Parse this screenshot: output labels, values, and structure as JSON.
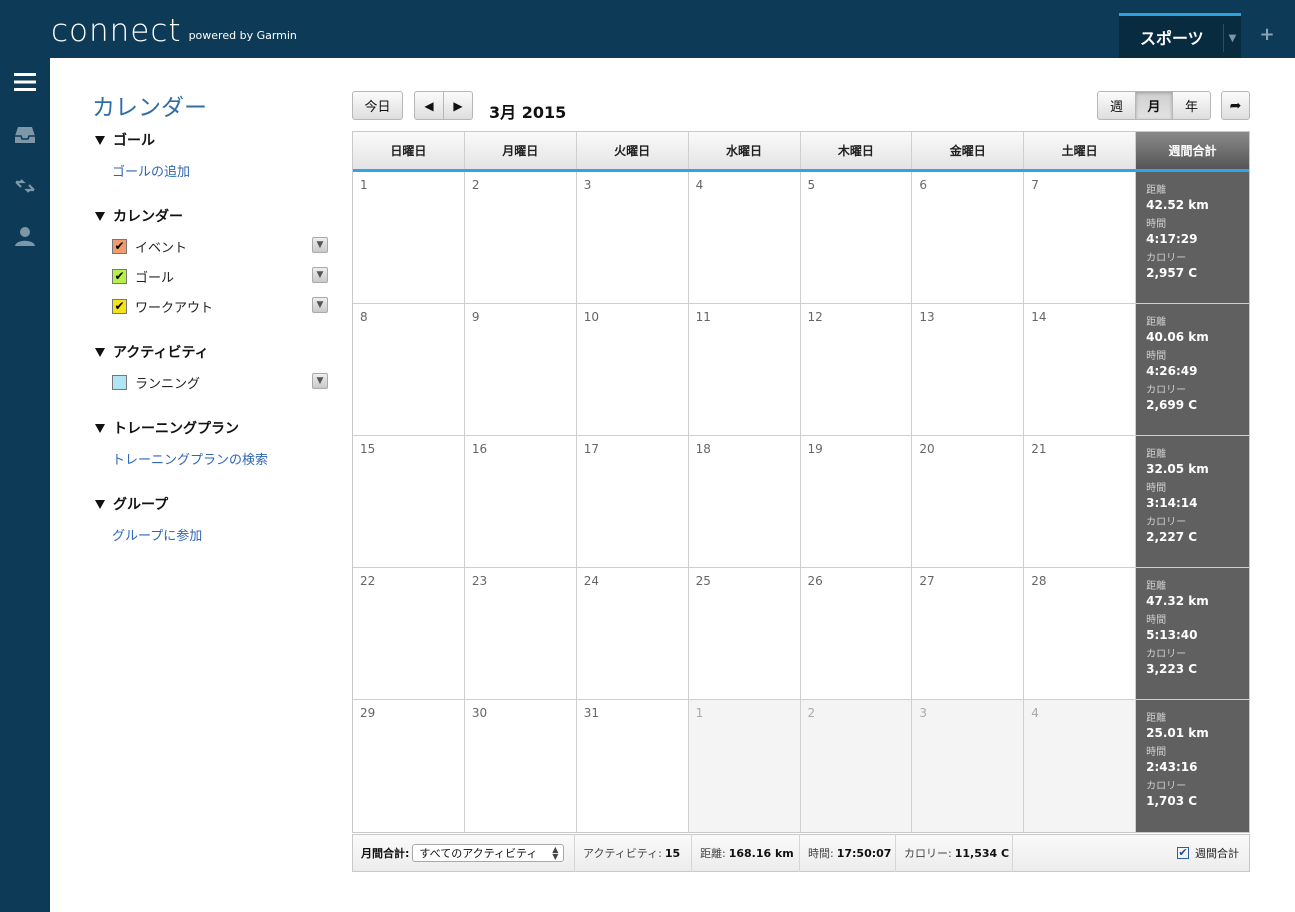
{
  "app": {
    "logo": "connect",
    "logo_sub": "powered by Garmin"
  },
  "topnav": {
    "tab_label": "スポーツ",
    "plus": "+"
  },
  "sidebar": {
    "title": "カレンダー",
    "goals": {
      "header": "ゴール",
      "link": "ゴールの追加"
    },
    "calendars": {
      "header": "カレンダー",
      "items": [
        {
          "label": "イベント",
          "color": "#f39b6d",
          "checked": true
        },
        {
          "label": "ゴール",
          "color": "#b8f04a",
          "checked": true
        },
        {
          "label": "ワークアウト",
          "color": "#f6e21a",
          "checked": true
        }
      ]
    },
    "activities": {
      "header": "アクティビティ",
      "items": [
        {
          "label": "ランニング",
          "color": "#aee6f6",
          "checked": false
        }
      ]
    },
    "training": {
      "header": "トレーニングプラン",
      "link": "トレーニングプランの検索"
    },
    "groups": {
      "header": "グループ",
      "link": "グループに参加"
    }
  },
  "toolbar": {
    "today": "今日",
    "prev": "◀",
    "next": "▶",
    "month_title": "3月 2015",
    "views": [
      "週",
      "月",
      "年"
    ],
    "active_view": "月",
    "share": "➦"
  },
  "calendar": {
    "weekdays": [
      "日曜日",
      "月曜日",
      "火曜日",
      "水曜日",
      "木曜日",
      "金曜日",
      "土曜日"
    ],
    "total_header": "週間合計",
    "weeks": [
      {
        "days": [
          "1",
          "2",
          "3",
          "4",
          "5",
          "6",
          "7"
        ],
        "other": [
          false,
          false,
          false,
          false,
          false,
          false,
          false
        ],
        "totals": {
          "distance_label": "距離",
          "distance": "42.52 km",
          "time_label": "時間",
          "time": "4:17:29",
          "cal_label": "カロリー",
          "calories": "2,957 C"
        }
      },
      {
        "days": [
          "8",
          "9",
          "10",
          "11",
          "12",
          "13",
          "14"
        ],
        "other": [
          false,
          false,
          false,
          false,
          false,
          false,
          false
        ],
        "totals": {
          "distance_label": "距離",
          "distance": "40.06 km",
          "time_label": "時間",
          "time": "4:26:49",
          "cal_label": "カロリー",
          "calories": "2,699 C"
        }
      },
      {
        "days": [
          "15",
          "16",
          "17",
          "18",
          "19",
          "20",
          "21"
        ],
        "other": [
          false,
          false,
          false,
          false,
          false,
          false,
          false
        ],
        "totals": {
          "distance_label": "距離",
          "distance": "32.05 km",
          "time_label": "時間",
          "time": "3:14:14",
          "cal_label": "カロリー",
          "calories": "2,227 C"
        }
      },
      {
        "days": [
          "22",
          "23",
          "24",
          "25",
          "26",
          "27",
          "28"
        ],
        "other": [
          false,
          false,
          false,
          false,
          false,
          false,
          false
        ],
        "totals": {
          "distance_label": "距離",
          "distance": "47.32 km",
          "time_label": "時間",
          "time": "5:13:40",
          "cal_label": "カロリー",
          "calories": "3,223 C"
        }
      },
      {
        "days": [
          "29",
          "30",
          "31",
          "1",
          "2",
          "3",
          "4"
        ],
        "other": [
          false,
          false,
          false,
          true,
          true,
          true,
          true
        ],
        "totals": {
          "distance_label": "距離",
          "distance": "25.01 km",
          "time_label": "時間",
          "time": "2:43:16",
          "cal_label": "カロリー",
          "calories": "1,703 C"
        }
      }
    ]
  },
  "footer": {
    "monthly_label": "月間合計:",
    "filter_value": "すべてのアクティビティ",
    "activities_label": "アクティビティ:",
    "activities_value": "15",
    "distance_label": "距離:",
    "distance_value": "168.16 km",
    "time_label": "時間:",
    "time_value": "17:50:07",
    "calories_label": "カロリー:",
    "calories_value": "11,534 C",
    "weekly_total_label": "週間合計",
    "weekly_total_checked": true
  }
}
